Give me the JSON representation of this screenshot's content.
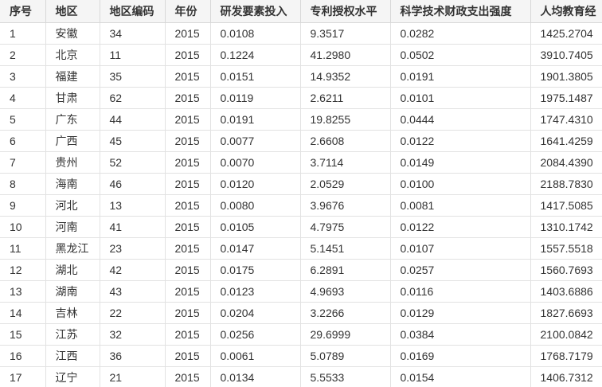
{
  "table": {
    "headers": [
      "序号",
      "地区",
      "地区编码",
      "年份",
      "研发要素投入",
      "专利授权水平",
      "科学技术财政支出强度",
      "人均教育经"
    ],
    "rows": [
      [
        "1",
        "安徽",
        "34",
        "2015",
        "0.0108",
        "9.3517",
        "0.0282",
        "1425.2704"
      ],
      [
        "2",
        "北京",
        "11",
        "2015",
        "0.1224",
        "41.2980",
        "0.0502",
        "3910.7405"
      ],
      [
        "3",
        "福建",
        "35",
        "2015",
        "0.0151",
        "14.9352",
        "0.0191",
        "1901.3805"
      ],
      [
        "4",
        "甘肃",
        "62",
        "2015",
        "0.0119",
        "2.6211",
        "0.0101",
        "1975.1487"
      ],
      [
        "5",
        "广东",
        "44",
        "2015",
        "0.0191",
        "19.8255",
        "0.0444",
        "1747.4310"
      ],
      [
        "6",
        "广西",
        "45",
        "2015",
        "0.0077",
        "2.6608",
        "0.0122",
        "1641.4259"
      ],
      [
        "7",
        "贵州",
        "52",
        "2015",
        "0.0070",
        "3.7114",
        "0.0149",
        "2084.4390"
      ],
      [
        "8",
        "海南",
        "46",
        "2015",
        "0.0120",
        "2.0529",
        "0.0100",
        "2188.7830"
      ],
      [
        "9",
        "河北",
        "13",
        "2015",
        "0.0080",
        "3.9676",
        "0.0081",
        "1417.5085"
      ],
      [
        "10",
        "河南",
        "41",
        "2015",
        "0.0105",
        "4.7975",
        "0.0122",
        "1310.1742"
      ],
      [
        "11",
        "黑龙江",
        "23",
        "2015",
        "0.0147",
        "5.1451",
        "0.0107",
        "1557.5518"
      ],
      [
        "12",
        "湖北",
        "42",
        "2015",
        "0.0175",
        "6.2891",
        "0.0257",
        "1560.7693"
      ],
      [
        "13",
        "湖南",
        "43",
        "2015",
        "0.0123",
        "4.9693",
        "0.0116",
        "1403.6886"
      ],
      [
        "14",
        "吉林",
        "22",
        "2015",
        "0.0204",
        "3.2266",
        "0.0129",
        "1827.6693"
      ],
      [
        "15",
        "江苏",
        "32",
        "2015",
        "0.0256",
        "29.6999",
        "0.0384",
        "2100.0842"
      ],
      [
        "16",
        "江西",
        "36",
        "2015",
        "0.0061",
        "5.0789",
        "0.0169",
        "1768.7179"
      ],
      [
        "17",
        "辽宁",
        "21",
        "2015",
        "0.0134",
        "5.5533",
        "0.0154",
        "1406.7312"
      ]
    ]
  }
}
